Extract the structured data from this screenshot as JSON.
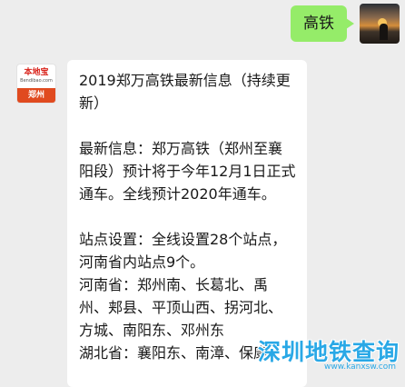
{
  "chat": {
    "outgoing": {
      "text": "高铁"
    },
    "incoming": {
      "avatar": {
        "name": "本地宝",
        "domain": "Bendibao.com",
        "city": "郑州"
      },
      "paragraphs": [
        "2019郑万高铁最新信息（持续更新）",
        "",
        "最新信息：郑万高铁（郑州至襄阳段）预计将于今年12月1日正式通车。全线预计2020年通车。",
        "",
        "站点设置：全线设置28个站点，河南省内站点9个。",
        "河南省：郑州南、长葛北、禹州、郏县、平顶山西、拐河北、方城、南阳东、邓州东",
        "湖北省：襄阳东、南漳、保康"
      ]
    }
  },
  "watermark": {
    "text": "深圳地铁查询",
    "domain": "www.kanxsw.com"
  },
  "colors": {
    "outgoing_bubble": "#95ec69",
    "background": "#ededed",
    "watermark": "#29a8e6"
  }
}
